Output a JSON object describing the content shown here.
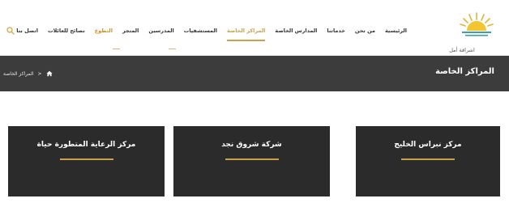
{
  "brand": {
    "logo_text": "اشراقة أمل"
  },
  "nav": {
    "items": [
      {
        "label": "الرئيسية",
        "state": "normal"
      },
      {
        "label": "من نحن",
        "state": "normal"
      },
      {
        "label": "خدماتنا",
        "state": "normal"
      },
      {
        "label": "المدارس الخاصة",
        "state": "normal"
      },
      {
        "label": "المراكز الخاصة",
        "state": "active"
      },
      {
        "label": "المستشفيات",
        "state": "normal"
      },
      {
        "label": "المدرسين",
        "state": "normal"
      },
      {
        "label": "المتجر",
        "state": "normal"
      },
      {
        "label": "التطوع",
        "state": "highlight"
      },
      {
        "label": "نصائح للعائلات",
        "state": "normal"
      },
      {
        "label": "اتصل بنا",
        "state": "normal"
      }
    ],
    "search_icon": "search-icon"
  },
  "title_bar": {
    "title": "المراكز الخاصة",
    "breadcrumb": {
      "home_icon": "home-icon",
      "separator": "<",
      "current": "المراكز الخاصة"
    }
  },
  "cards": [
    {
      "title": "مركز نبراس الخليج"
    },
    {
      "title": "شركة شروق نجد"
    },
    {
      "title": "مركز الرعاية المتطورة حياة"
    }
  ],
  "colors": {
    "accent_gold": "#c9a14a",
    "highlight_orange": "#d09028",
    "title_bar_bg": "#3c3c3c",
    "card_bg": "#2b2b2b",
    "text_dark": "#333333"
  }
}
